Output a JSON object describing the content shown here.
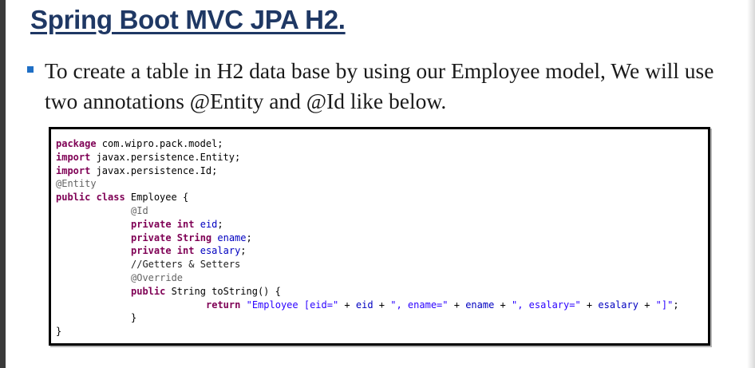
{
  "slide": {
    "title": "Spring Boot MVC JPA H2.",
    "bullet": "To create a table in H2 data base by using our Employee model, We will use two annotations @Entity and @Id like below."
  },
  "code": {
    "l1_kw": "package",
    "l1_rest": " com.wipro.pack.model;",
    "l2_kw": "import",
    "l2_rest": " javax.persistence.Entity;",
    "l3_kw": "import",
    "l3_rest": " javax.persistence.Id;",
    "l4_ann": "@Entity",
    "l5_kw": "public class",
    "l5_rest": " Employee {",
    "l6_ann": "@Id",
    "l7_kw": "private int",
    "l7_field": "eid",
    "l8_kw": "private",
    "l8_type": " String ",
    "l8_field": "ename",
    "l9_kw": "private int",
    "l9_field": "esalary",
    "l10_comment": "//Getters & Setters",
    "l11_ann": "@Override",
    "l12_kw": "public",
    "l12_rest": " String toString() {",
    "l13_kw": "return",
    "l13_s1": "\"Employee [eid=\"",
    "l13_p1": " + ",
    "l13_f1": "eid",
    "l13_p2": " + ",
    "l13_s2": "\", ename=\"",
    "l13_p3": " + ",
    "l13_f2": "ename",
    "l13_p4": " + ",
    "l13_s3": "\", esalary=\"",
    "l13_p5": " + ",
    "l13_f3": "esalary",
    "l13_p6": " + ",
    "l13_s4": "\"]\"",
    "l13_end": ";",
    "close_inner": "}",
    "close_outer": "}",
    "semi": ";"
  }
}
